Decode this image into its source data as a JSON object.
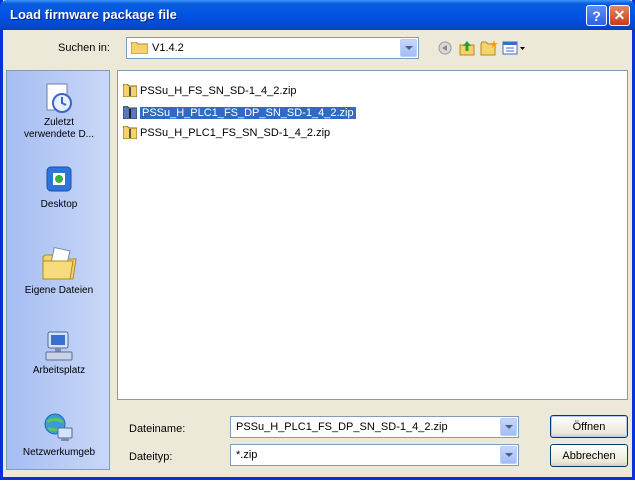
{
  "window": {
    "title": "Load firmware package file"
  },
  "title_buttons": {
    "help": "?",
    "close": "✕"
  },
  "lookin": {
    "label": "Suchen in:",
    "value": "V1.4.2"
  },
  "toolbar": [
    "back-icon",
    "up-folder-icon",
    "new-folder-icon",
    "views-menu-icon"
  ],
  "places": [
    {
      "label": "Zuletzt\nverwendete D...",
      "icon": "recent-documents-icon"
    },
    {
      "label": "Desktop",
      "icon": "desktop-icon"
    },
    {
      "label": "Eigene Dateien",
      "icon": "my-documents-icon"
    },
    {
      "label": "Arbeitsplatz",
      "icon": "my-computer-icon"
    },
    {
      "label": "Netzwerkumgeb",
      "icon": "network-icon"
    }
  ],
  "files": [
    {
      "name": "PSSu_H_FS_SN_SD-1_4_2.zip",
      "selected": false
    },
    {
      "name": "PSSu_H_PLC1_FS_DP_SN_SD-1_4_2.zip",
      "selected": true
    },
    {
      "name": "PSSu_H_PLC1_FS_SN_SD-1_4_2.zip",
      "selected": false
    }
  ],
  "filename": {
    "label": "Dateiname:",
    "value": "PSSu_H_PLC1_FS_DP_SN_SD-1_4_2.zip"
  },
  "filetype": {
    "label": "Dateityp:",
    "value": "*.zip"
  },
  "buttons": {
    "open": "Öffnen",
    "cancel": "Abbrechen"
  },
  "colors": {
    "titlebar": "#0054e3",
    "selection": "#316ac5",
    "dialog_bg": "#ece9d8",
    "places_bar": "#a6bdf3"
  }
}
